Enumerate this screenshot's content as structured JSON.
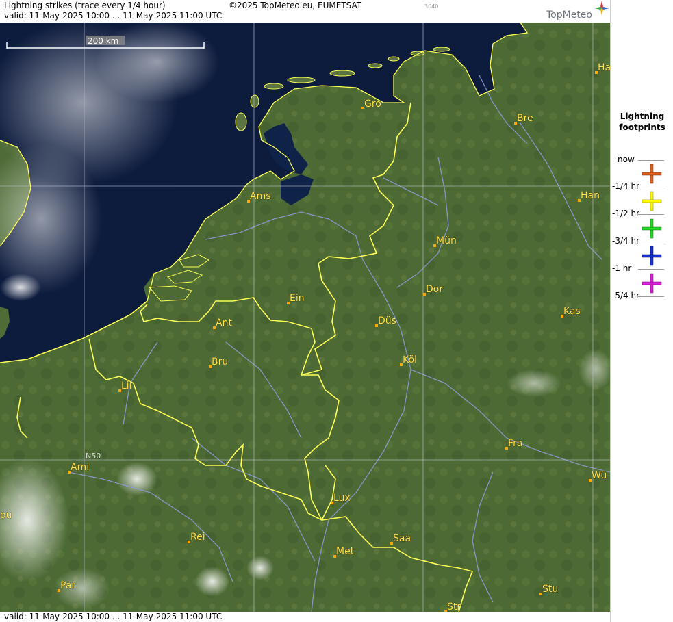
{
  "header": {
    "title": "Lightning strikes (trace every 1/4 hour)",
    "copyright": "©2025 TopMeteo.eu, EUMETSAT",
    "code": "3040",
    "valid": "valid:  11-May-2025 10:00 ... 11-May-2025 11:00 UTC",
    "brand": "TopMeteo"
  },
  "footer": {
    "valid": "valid:  11-May-2025 10:00 ... 11-May-2025 11:00 UTC"
  },
  "map": {
    "scale_label": "200 km",
    "grid_label": "N50",
    "cities": [
      {
        "name": "Gro"
      },
      {
        "name": "Bre"
      },
      {
        "name": "Ha"
      },
      {
        "name": "Ams"
      },
      {
        "name": "Han"
      },
      {
        "name": "Mün"
      },
      {
        "name": "Ein"
      },
      {
        "name": "Dor"
      },
      {
        "name": "Kas"
      },
      {
        "name": "Ant"
      },
      {
        "name": "Düs"
      },
      {
        "name": "Köl"
      },
      {
        "name": "Bru"
      },
      {
        "name": "Lil"
      },
      {
        "name": "Fra"
      },
      {
        "name": "Ami"
      },
      {
        "name": "Wü"
      },
      {
        "name": "Lux"
      },
      {
        "name": "Rei"
      },
      {
        "name": "Saa"
      },
      {
        "name": "Met"
      },
      {
        "name": "ou"
      },
      {
        "name": "Par"
      },
      {
        "name": "Stu"
      },
      {
        "name": "Str"
      }
    ]
  },
  "legend": {
    "title_line1": "Lightning",
    "title_line2": "footprints",
    "items": [
      {
        "label": "now"
      },
      {
        "label": "-1/4 hr",
        "color": "#e0611e"
      },
      {
        "label": "-1/2 hr",
        "color": "#ffff00"
      },
      {
        "label": "-3/4 hr",
        "color": "#22dd22"
      },
      {
        "label": "-1 hr",
        "color": "#1630d6"
      },
      {
        "label": "-5/4 hr",
        "color": "#e020e0"
      }
    ]
  },
  "colors": {
    "sea": "#0d1b3d",
    "land": "#4d6a34",
    "border": "#ffff55",
    "river": "#8c9bd6",
    "grid": "#b8b8c8"
  }
}
